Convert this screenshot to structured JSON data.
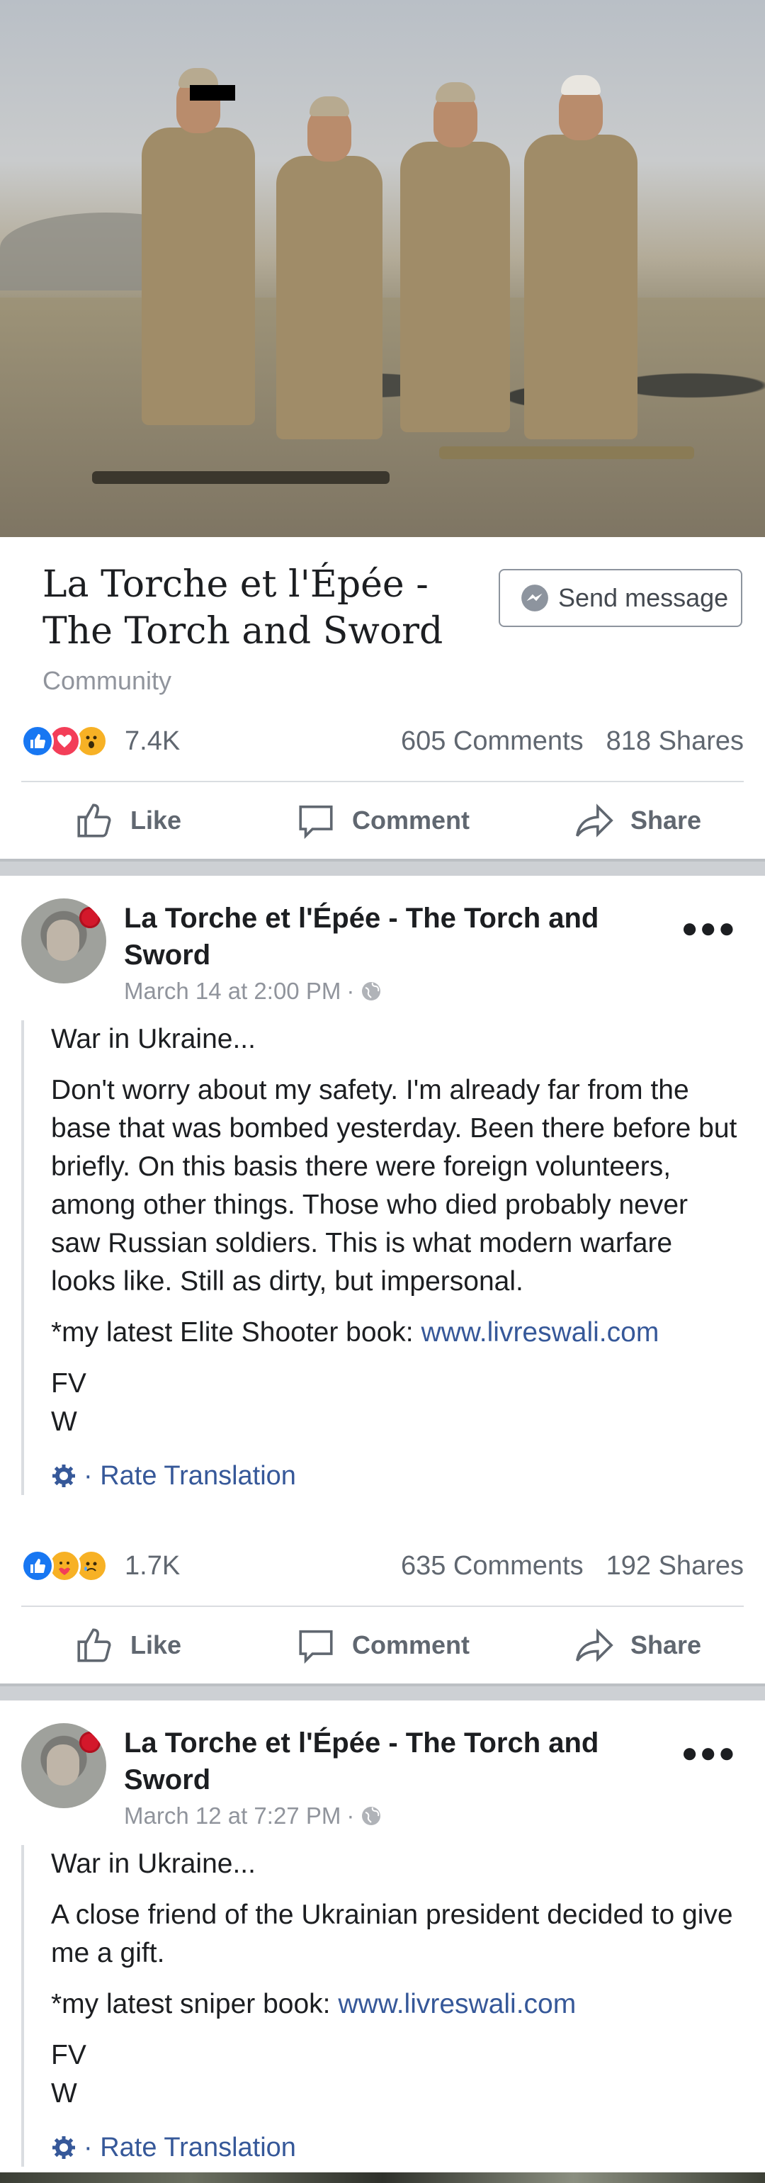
{
  "page": {
    "title": "La Torche et l'Épée - The Torch and Sword",
    "category": "Community",
    "send_message_label": "Send message",
    "reaction_count": "7.4K",
    "comments": "605 Comments",
    "shares": "818 Shares"
  },
  "actions": {
    "like": "Like",
    "comment": "Comment",
    "share": "Share"
  },
  "posts": [
    {
      "author": "La Torche et l'Épée - The Torch and Sword",
      "time": "March 14 at 2:00 PM",
      "separator": "·",
      "heading": "War in Ukraine...",
      "text": "Don't worry about my safety. I'm already far from the base that was bombed yesterday. Been there before but briefly. On this basis there were foreign volunteers, among other things. Those who died probably never saw Russian soldiers. This is what modern warfare looks like. Still as dirty, but impersonal.",
      "promo_prefix": "*my latest Elite Shooter book: ",
      "promo_link": "www.livreswali.com",
      "sign1": "FV",
      "sign2": "W",
      "rate": "· Rate Translation",
      "reaction_count": "1.7K",
      "comments": "635 Comments",
      "shares": "192 Shares"
    },
    {
      "author": "La Torche et l'Épée - The Torch and Sword",
      "time": "March 12 at 7:27 PM",
      "separator": "·",
      "heading": "War in Ukraine...",
      "text": "A close friend of the Ukrainian president decided to give me a gift.",
      "promo_prefix": "*my latest sniper book: ",
      "promo_link": "www.livreswali.com",
      "sign1": "FV",
      "sign2": "W",
      "rate": "· Rate Translation"
    }
  ],
  "colors": {
    "link": "#365899",
    "like_blue": "#1877f2",
    "muted": "#90949c"
  }
}
